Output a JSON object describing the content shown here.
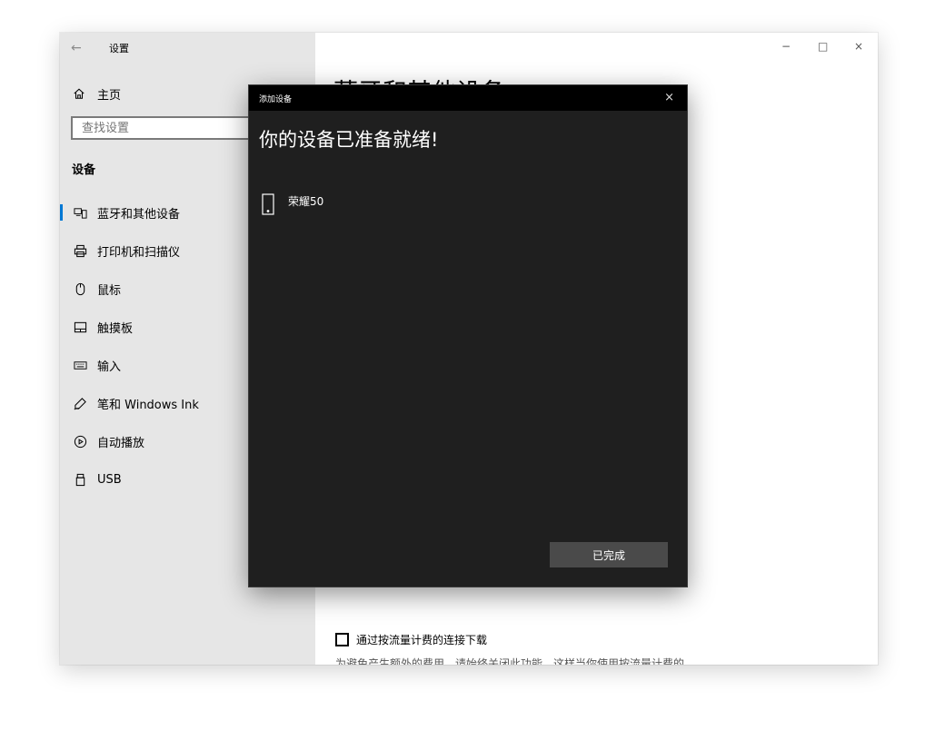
{
  "window": {
    "title": "设置",
    "back_icon": "←",
    "controls": {
      "minimize": "−",
      "maximize": "□",
      "close": "×"
    }
  },
  "sidebar": {
    "home_label": "主页",
    "search_placeholder": "查找设置",
    "section_title": "设备",
    "items": [
      {
        "label": "蓝牙和其他设备",
        "icon": "bluetooth-devices-icon",
        "active": true
      },
      {
        "label": "打印机和扫描仪",
        "icon": "printer-icon",
        "active": false
      },
      {
        "label": "鼠标",
        "icon": "mouse-icon",
        "active": false
      },
      {
        "label": "触摸板",
        "icon": "touchpad-icon",
        "active": false
      },
      {
        "label": "输入",
        "icon": "keyboard-icon",
        "active": false
      },
      {
        "label": "笔和 Windows Ink",
        "icon": "pen-icon",
        "active": false
      },
      {
        "label": "自动播放",
        "icon": "autoplay-icon",
        "active": false
      },
      {
        "label": "USB",
        "icon": "usb-icon",
        "active": false
      }
    ]
  },
  "main": {
    "page_title": "蓝牙和其他设备",
    "checkbox_label": "通过按流量计费的连接下载",
    "description": "为避免产生额外的费用，请始终关闭此功能，这样当你使用按流量计费的"
  },
  "dialog": {
    "title": "添加设备",
    "close": "×",
    "heading": "你的设备已准备就绪!",
    "device_name": "荣耀50",
    "done_button": "已完成"
  },
  "colors": {
    "accent": "#0078d4",
    "sidebar_bg": "#e6e6e6",
    "dialog_bg": "#1f1f1f",
    "dialog_titlebar": "#000000",
    "button_bg": "#4a4a4a"
  }
}
